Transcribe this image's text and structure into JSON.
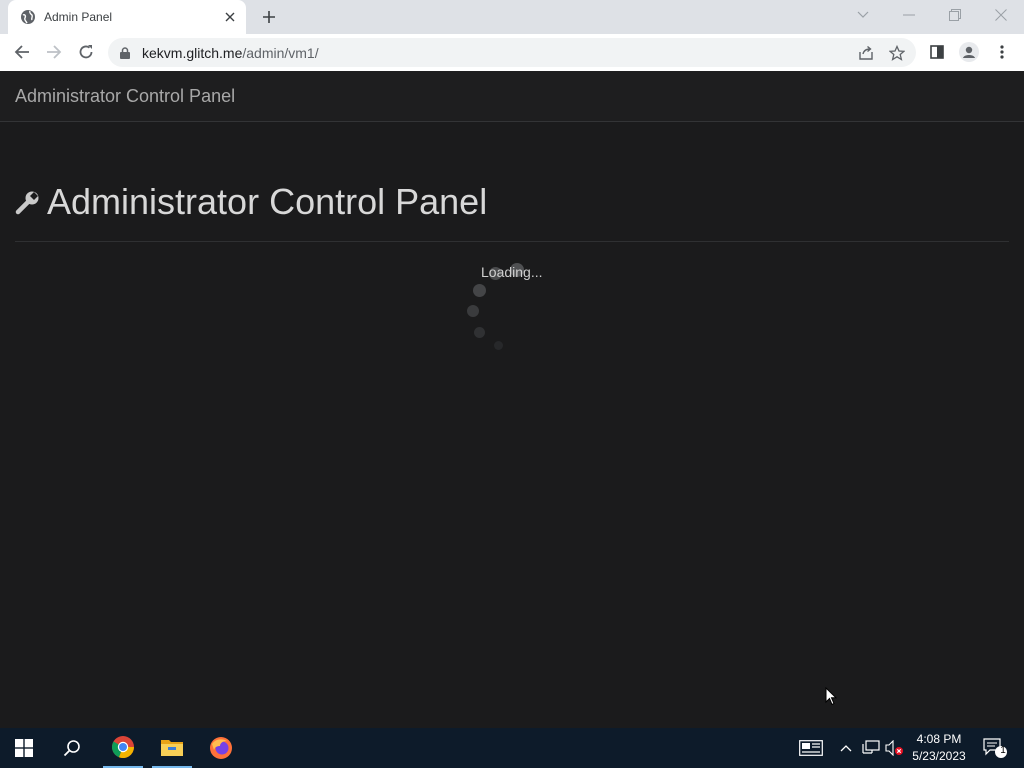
{
  "browser": {
    "tab_title": "Admin Panel",
    "url_host": "kekvm.glitch.me",
    "url_path": "/admin/vm1/"
  },
  "page": {
    "navbar_brand": "Administrator Control Panel",
    "heading": "Administrator Control Panel",
    "loading_text": "Loading..."
  },
  "taskbar": {
    "time": "4:08 PM",
    "date": "5/23/2023",
    "notification_count": "1"
  },
  "colors": {
    "page_background": "#1b1b1c",
    "taskbar_background": "#0d1b2a",
    "tabstrip_background": "#dee1e6"
  }
}
